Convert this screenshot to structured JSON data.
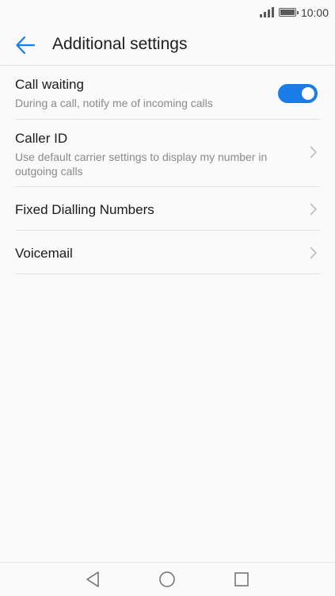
{
  "status_bar": {
    "time": "10:00",
    "icons": [
      "signal-icon",
      "battery-icon"
    ]
  },
  "header": {
    "title": "Additional settings",
    "back_icon": "back-arrow-icon",
    "accent_color": "#1a7ce8"
  },
  "settings": [
    {
      "label": "Call waiting",
      "description": "During a call, notify me of incoming calls",
      "control": "toggle",
      "enabled": true
    },
    {
      "label": "Caller ID",
      "description": "Use default carrier settings to display my number in outgoing calls",
      "control": "chevron"
    },
    {
      "label": "Fixed Dialling Numbers",
      "control": "chevron"
    },
    {
      "label": "Voicemail",
      "control": "chevron"
    }
  ],
  "nav_bar": {
    "buttons": [
      "back-triangle-icon",
      "home-circle-icon",
      "recents-square-icon"
    ]
  }
}
